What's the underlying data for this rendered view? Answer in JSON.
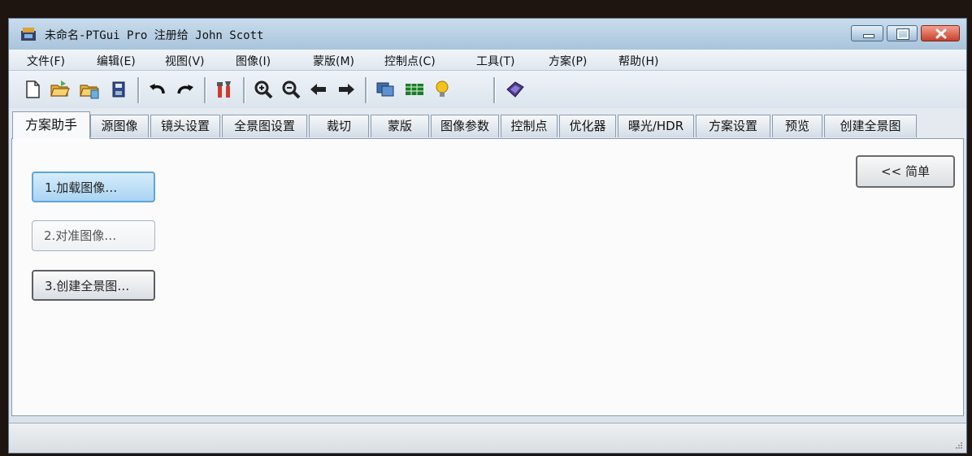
{
  "window": {
    "title": "未命名-PTGui Pro 注册给 John Scott"
  },
  "titlebar_icons": {
    "app": "ptgui-app-icon",
    "minimize": "minimize-icon",
    "maximize": "maximize-icon",
    "close": "close-icon"
  },
  "menu": [
    {
      "label": "文件(F)"
    },
    {
      "label": "编辑(E)"
    },
    {
      "label": "视图(V)"
    },
    {
      "label": "图像(I)"
    },
    {
      "label": "蒙版(M)"
    },
    {
      "label": "控制点(C)"
    },
    {
      "label": "工具(T)"
    },
    {
      "label": "方案(P)"
    },
    {
      "label": "帮助(H)"
    }
  ],
  "toolbar": [
    "new-file-icon",
    "open-folder-icon",
    "open-recent-icon",
    "save-icon",
    "undo-icon",
    "redo-icon",
    "tools-icon",
    "zoom-in-icon",
    "zoom-out-icon",
    "arrow-left-icon",
    "arrow-right-icon",
    "panorama-editor-icon",
    "table-editor-icon",
    "lightbulb-icon",
    "help-book-icon"
  ],
  "tabs": [
    {
      "label": "方案助手"
    },
    {
      "label": "源图像"
    },
    {
      "label": "镜头设置"
    },
    {
      "label": "全景图设置"
    },
    {
      "label": "裁切"
    },
    {
      "label": "蒙版"
    },
    {
      "label": "图像参数"
    },
    {
      "label": "控制点"
    },
    {
      "label": "优化器"
    },
    {
      "label": "曝光/HDR"
    },
    {
      "label": "方案设置"
    },
    {
      "label": "预览"
    },
    {
      "label": "创建全景图"
    }
  ],
  "assistant": {
    "load_images": "1.加载图像…",
    "align_images": "2.对准图像…",
    "create_panorama": "3.创建全景图…",
    "simple": "<< 简单"
  },
  "colors": {
    "titlebar": "#b8d0e6",
    "close": "#c8402a",
    "active_button_border": "#5ea5dc"
  }
}
